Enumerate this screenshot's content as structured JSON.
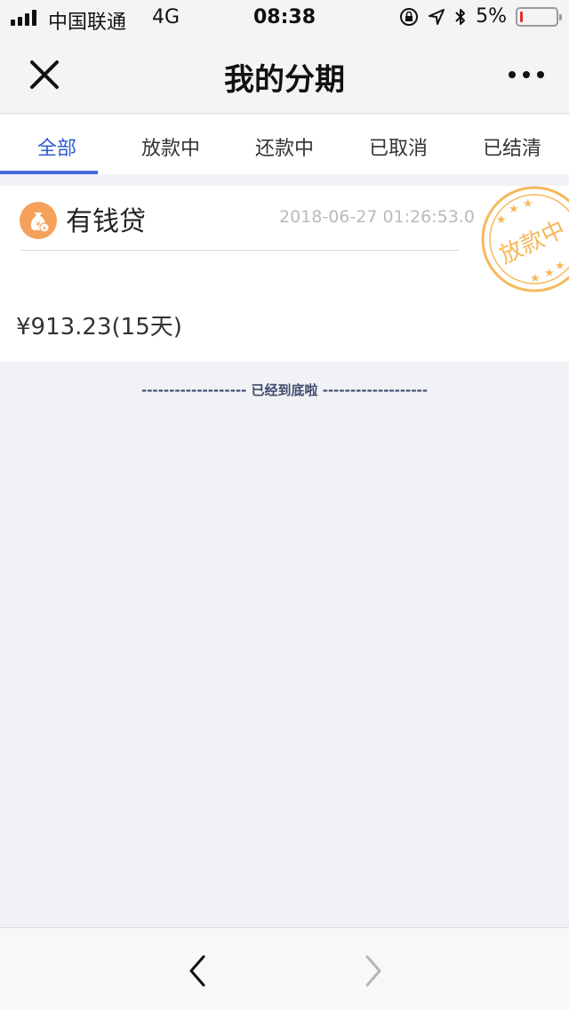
{
  "status_bar": {
    "carrier": "中国联通",
    "network": "4G",
    "time": "08:38",
    "battery": "5%",
    "icons": [
      "signal-icon",
      "orientation-lock-icon",
      "location-icon",
      "bluetooth-icon",
      "battery-icon"
    ]
  },
  "nav": {
    "title": "我的分期",
    "close_icon": "close-icon",
    "more_icon": "more-icon"
  },
  "tabs": [
    {
      "label": "全部",
      "active": true
    },
    {
      "label": "放款中",
      "active": false
    },
    {
      "label": "还款中",
      "active": false
    },
    {
      "label": "已取消",
      "active": false
    },
    {
      "label": "已结清",
      "active": false
    }
  ],
  "loan": {
    "lender": "有钱贷",
    "time": "2018-06-27 01:26:53.0",
    "amount": "¥913.23(15天)",
    "stamp_text": "放款中"
  },
  "end_note": "------------------- 已经到底啦 -------------------",
  "colors": {
    "accent": "#4a6be0",
    "stamp": "#f5b95c",
    "lender_icon": "#f5a15c",
    "background": "#f1f2f6"
  }
}
